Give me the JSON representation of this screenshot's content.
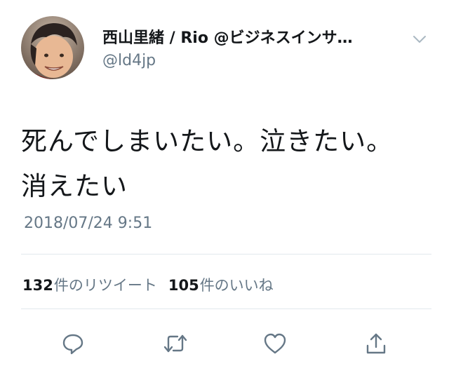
{
  "user": {
    "display_name": "西山里緒 / Rio @ビジネスインサ…",
    "handle": "@ld4jp"
  },
  "tweet": {
    "text": "死んでしまいたい。泣きたい。消えたい",
    "timestamp": "2018/07/24 9:51"
  },
  "stats": {
    "retweets_count": "132",
    "retweets_label": "件のリツイート",
    "likes_count": "105",
    "likes_label": "件のいいね"
  },
  "actions": [
    {
      "icon": "reply-icon"
    },
    {
      "icon": "retweet-icon"
    },
    {
      "icon": "like-icon"
    },
    {
      "icon": "share-icon"
    }
  ],
  "colors": {
    "text": "#14171a",
    "secondary": "#657786",
    "divider": "#e1e8ed",
    "icon": "#657786"
  }
}
